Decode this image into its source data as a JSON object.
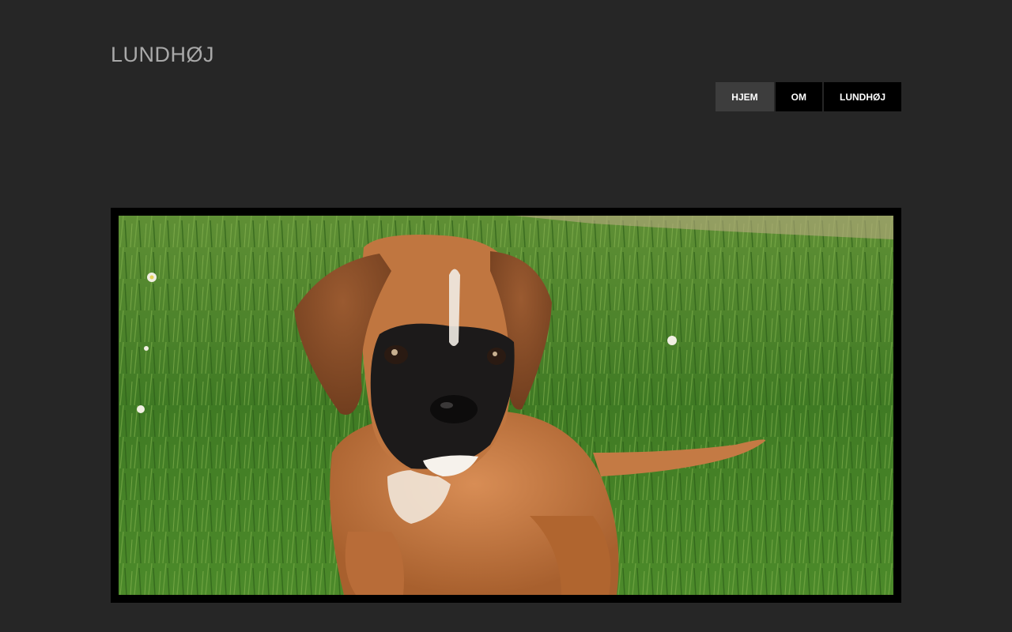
{
  "site": {
    "title": "LUNDHØJ"
  },
  "nav": {
    "items": [
      {
        "label": "HJEM",
        "active": true
      },
      {
        "label": "OM",
        "active": false
      },
      {
        "label": "LUNDHØJ",
        "active": false
      }
    ]
  },
  "hero": {
    "image_subject": "boxer-puppy-on-grass",
    "colors": {
      "grass": "#3f7a24",
      "fur": "#c47a44",
      "muzzle": "#1c1a1a"
    }
  }
}
